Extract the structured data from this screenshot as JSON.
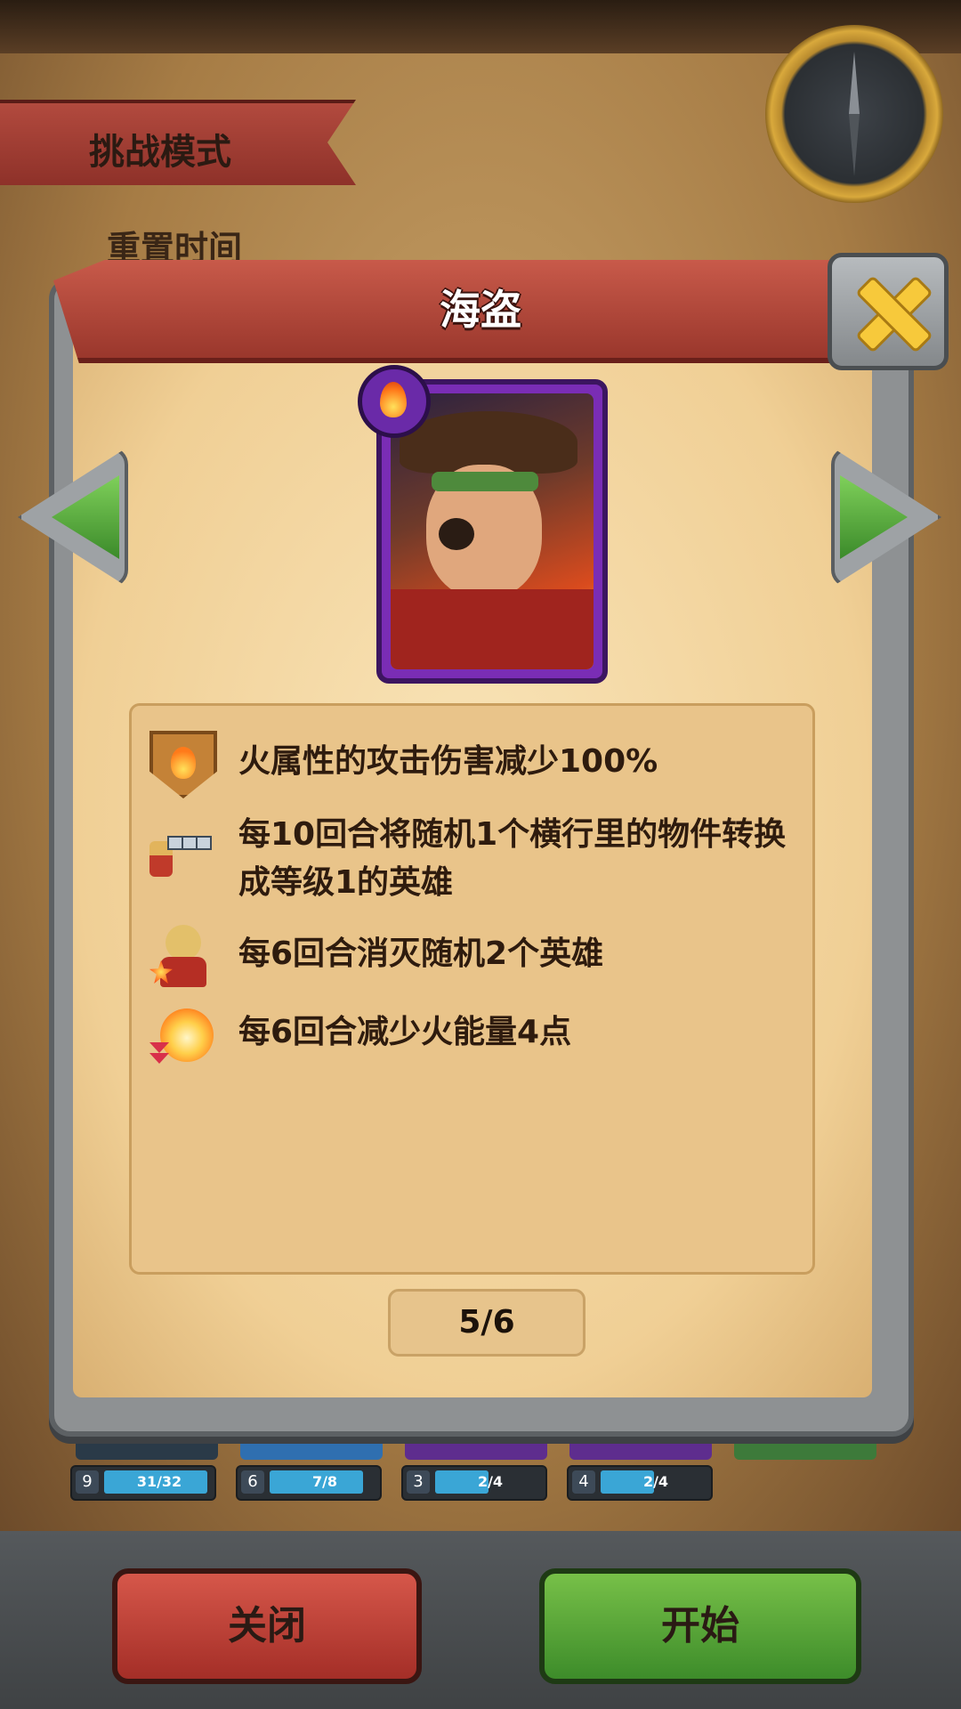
{
  "background": {
    "mode_title": "挑战模式",
    "reset_label": "重置时间",
    "heroes": [
      {
        "level": "9",
        "count": "31/32",
        "progress": 0.97,
        "color": "#2f5f86"
      },
      {
        "level": "6",
        "count": "7/8",
        "progress": 0.875,
        "color": "#2f6fb0"
      },
      {
        "level": "3",
        "count": "2/4",
        "progress": 0.5,
        "color": "#5e2d8e"
      },
      {
        "level": "4",
        "count": "2/4",
        "progress": 0.5,
        "color": "#5e2d8e"
      }
    ]
  },
  "modal": {
    "title": "海盗",
    "element": "fire-icon",
    "effects": [
      {
        "icon": "fire-shield-icon",
        "text": "火属性的攻击伤害减少100%"
      },
      {
        "icon": "row-transform-icon",
        "text": "每10回合将随机1个横行里的物件转换成等级1的英雄"
      },
      {
        "icon": "hero-destroy-icon",
        "text": "每6回合消灭随机2个英雄"
      },
      {
        "icon": "fire-energy-down-icon",
        "text": "每6回合减少火能量4点"
      }
    ],
    "pager": "5/6"
  },
  "buttons": {
    "close": "关闭",
    "start": "开始"
  },
  "colors": {
    "ribbon": "#b24a3e",
    "close_button": "#c04437",
    "start_button": "#5aa83a",
    "card_frame": "#7a2db5"
  }
}
